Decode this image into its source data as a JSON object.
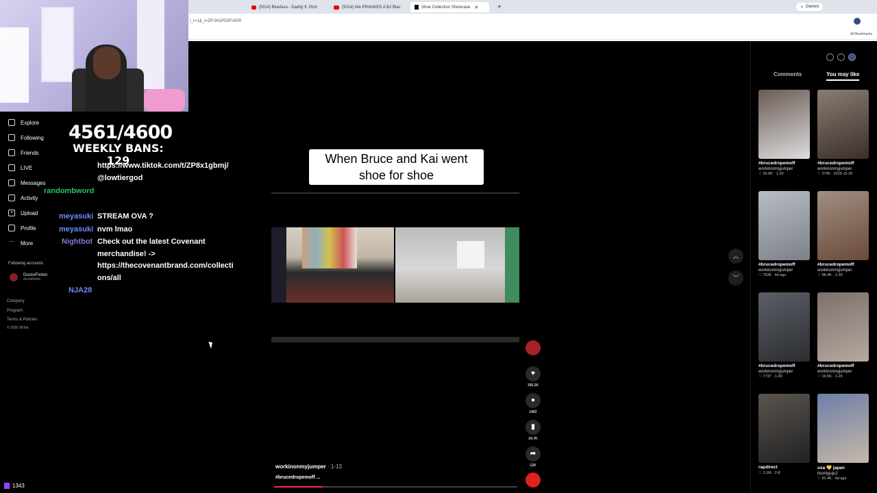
{
  "browser": {
    "tabs": [
      {
        "label": "(5014) Blueface - Daddy ft. Rich",
        "icon": "youtube-icon"
      },
      {
        "label": "(5014) We PRANKED A BJ Blac",
        "icon": "youtube-icon"
      },
      {
        "label": "Shoe Collection Showcase",
        "icon": "tiktok-icon"
      }
    ],
    "url": "/_r=1&_t=ZP-941PD5FofGR",
    "gemini_label": "Gemini",
    "bookmarks_label": "All Bookmarks"
  },
  "overlay": {
    "counter": "4561/4600",
    "weekly_bans": "WEEKLY BANS: 129"
  },
  "tiktok_nav": {
    "items": [
      "Explore",
      "Following",
      "Friends",
      "LIVE",
      "Messages",
      "Activity",
      "Upload",
      "Profile",
      "More"
    ],
    "following_heading": "Following accounts",
    "following_account": {
      "name": "DoctorFiction",
      "handle": "doctafiction"
    },
    "footer": [
      "Company",
      "Program",
      "Terms & Policies",
      "© 2026 TikTok"
    ]
  },
  "chat": {
    "lines": [
      {
        "user": "",
        "text": "https://www.tiktok.com/t/ZP8x1gbmj/",
        "user_color": "#ffffff"
      },
      {
        "user": "",
        "text": "@lowtiergod",
        "user_color": "#ffffff"
      },
      {
        "user": "randombword",
        "text": "",
        "user_color": "#22c55e"
      },
      {
        "user": "meyasuki",
        "text": "STREAM OVA ?",
        "user_color": "#6b8cff"
      },
      {
        "user": "meyasuki",
        "text": "nvm lmao",
        "user_color": "#6b8cff"
      },
      {
        "user": "Nightbot",
        "text": "Check out the latest Covenant",
        "user_color": "#7b7bd6"
      },
      {
        "user": "",
        "text": "merchandise! ->",
        "user_color": "#ffffff"
      },
      {
        "user": "",
        "text": "https://thecovenantbrand.com/collecti",
        "user_color": "#ffffff"
      },
      {
        "user": "",
        "text": "ons/all",
        "user_color": "#ffffff"
      },
      {
        "user": "NJA28",
        "text": "",
        "user_color": "#6b8cff"
      }
    ]
  },
  "video": {
    "caption_line1": "When Bruce and Kai went",
    "caption_line2": "shoe for shoe",
    "uploader": "workinonmyjumper",
    "date": " · 1-13",
    "hashtag": "#brucedropemoff ...",
    "progress": 0.2,
    "likes": "355.2K",
    "comments": "1462",
    "saves": "24.7K",
    "shares": "12K"
  },
  "panel": {
    "tab_comments": "Comments",
    "tab_you_may_like": "You may like",
    "cards": [
      {
        "tag": "#brucedropemoff",
        "user": "workinonmyjumper",
        "stat": "♡ 20.6K · 1-20",
        "colors": [
          "#6a5b55",
          "#ddd"
        ]
      },
      {
        "tag": "#brucedropemoff",
        "user": "workinonmyjumper",
        "stat": "♡ 2746 · 2025-11-25",
        "colors": [
          "#8c7c70",
          "#3a2e2c"
        ]
      },
      {
        "tag": "#brucedropemoff",
        "user": "workinonmyjumper",
        "stat": "♡ 7536 · 4d ago",
        "colors": [
          "#b8bcc4",
          "#7c8088"
        ]
      },
      {
        "tag": "#brucedropemoff",
        "user": "workinonmyjumper",
        "stat": "♡ 68.4K · 1-20",
        "colors": [
          "#a08f82",
          "#6a4a3a"
        ]
      },
      {
        "tag": "#brucedropemoff",
        "user": "workinonmyjumper",
        "stat": "♡ 7737 · 1-20",
        "colors": [
          "#5b5f66",
          "#2b2d31"
        ]
      },
      {
        "tag": "#brucedropemoff",
        "user": "workinonmyjumper",
        "stat": "♡ 19.5K · 1-20",
        "colors": [
          "#7d6f6a",
          "#b7a9a1"
        ]
      },
      {
        "tag": "rapdirect",
        "user": "",
        "stat": "♡ 2.1M · 2-8",
        "colors": [
          "#5a544f",
          "#222"
        ]
      },
      {
        "tag": "usa 💛 japan",
        "user": "itsonlyjuju2",
        "stat": "♡ 91.4K · 4d ago",
        "colors": [
          "#6c7fa8",
          "#c7b8a8"
        ]
      }
    ]
  },
  "stream": {
    "viewers": "1343"
  }
}
